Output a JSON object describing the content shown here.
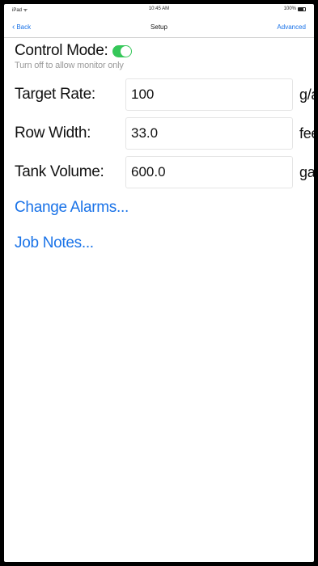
{
  "status_bar": {
    "carrier": "iPad ᯤ",
    "time": "10:45 AM",
    "battery_text": "100%"
  },
  "nav": {
    "back_label": "Back",
    "title": "Setup",
    "right_label": "Advanced"
  },
  "control_mode": {
    "label": "Control Mode:",
    "enabled": true,
    "hint": "Turn off to allow monitor only"
  },
  "fields": [
    {
      "label": "Target Rate:",
      "value": "100",
      "unit": "g/a"
    },
    {
      "label": "Row Width:",
      "value": "33.0",
      "unit": "feet"
    },
    {
      "label": "Tank Volume:",
      "value": "600.0",
      "unit": "gal"
    }
  ],
  "links": {
    "change_alarms": "Change Alarms...",
    "job_notes": "Job Notes..."
  },
  "colors": {
    "accent": "#1a73e8",
    "toggle_on": "#35c759"
  }
}
